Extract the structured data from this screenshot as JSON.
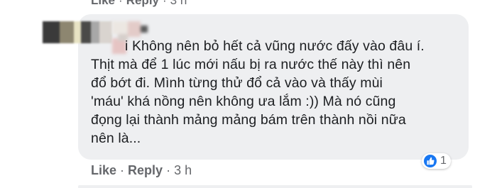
{
  "previous_comment": {
    "like_label": "Like",
    "reply_label": "Reply",
    "time": "3 h"
  },
  "comment": {
    "lines": [
      "i Không nên bỏ hết cả vũng nước đấy vào đâu í.",
      "Thịt mà để 1 lúc mới nấu bị ra nước thế này thì nên",
      "đổ bớt đi. Mình từng thử đổ cả vào và thấy mùi",
      "'máu' khá nồng nên không ưa lắm :)) Mà nó cũng",
      "đọng lại thành mảng mảng bám trên thành nồi nữa",
      "nên là..."
    ],
    "reaction_count": "1",
    "reaction_icon": "like-thumb-icon",
    "like_label": "Like",
    "reply_label": "Reply",
    "time": "3 h"
  },
  "colors": {
    "bubble": "#eeeff1",
    "text": "#1c1e21",
    "meta": "#65676b",
    "like_blue": "#1877f2"
  }
}
